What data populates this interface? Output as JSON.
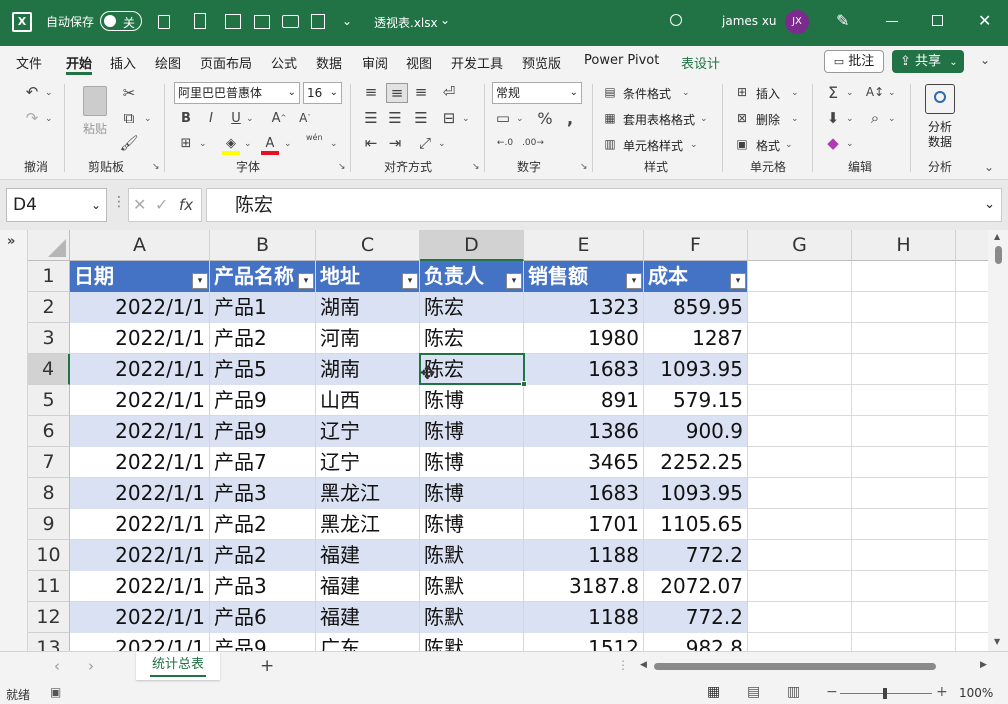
{
  "titlebar": {
    "autosave_label": "自动保存",
    "autosave_state": "关",
    "filename": "透视表.xlsx",
    "user_name": "james xu",
    "user_initials": "JX"
  },
  "menu": {
    "tabs": [
      "文件",
      "开始",
      "插入",
      "绘图",
      "页面布局",
      "公式",
      "数据",
      "审阅",
      "视图",
      "开发工具",
      "预览版",
      "Power Pivot",
      "表设计"
    ],
    "active_tab": "开始",
    "comment_button": "批注",
    "share_button": "共享"
  },
  "ribbon": {
    "groups": {
      "undo": "撤消",
      "clipboard": "剪贴板",
      "font": "字体",
      "align": "对齐方式",
      "number": "数字",
      "styles": "样式",
      "cells": "单元格",
      "edit": "编辑",
      "analysis": "分析"
    },
    "paste_label": "粘贴",
    "font_name": "阿里巴巴普惠体",
    "font_size": "16",
    "number_format": "常规",
    "cond_format": "条件格式",
    "table_format": "套用表格格式",
    "cell_style": "单元格样式",
    "insert": "插入",
    "delete": "删除",
    "format": "格式",
    "analyze_data_1": "分析",
    "analyze_data_2": "数据",
    "wen_label": "wén",
    "font_color": "#e81123",
    "highlight_color": "#ffff00"
  },
  "formula_bar": {
    "name_box": "D4",
    "fx": "fx",
    "content": "陈宏"
  },
  "grid": {
    "columns": [
      "A",
      "B",
      "C",
      "D",
      "E",
      "F",
      "G",
      "H"
    ],
    "row_numbers": [
      "1",
      "2",
      "3",
      "4",
      "5",
      "6",
      "7",
      "8",
      "9",
      "10",
      "11",
      "12",
      "13"
    ],
    "headers": [
      "日期",
      "产品名称",
      "地址",
      "负责人",
      "销售额",
      "成本"
    ],
    "rows": [
      [
        "2022/1/1",
        "产品1",
        "湖南",
        "陈宏",
        "1323",
        "859.95"
      ],
      [
        "2022/1/1",
        "产品2",
        "河南",
        "陈宏",
        "1980",
        "1287"
      ],
      [
        "2022/1/1",
        "产品5",
        "湖南",
        "陈宏",
        "1683",
        "1093.95"
      ],
      [
        "2022/1/1",
        "产品9",
        "山西",
        "陈博",
        "891",
        "579.15"
      ],
      [
        "2022/1/1",
        "产品9",
        "辽宁",
        "陈博",
        "1386",
        "900.9"
      ],
      [
        "2022/1/1",
        "产品7",
        "辽宁",
        "陈博",
        "3465",
        "2252.25"
      ],
      [
        "2022/1/1",
        "产品3",
        "黑龙江",
        "陈博",
        "1683",
        "1093.95"
      ],
      [
        "2022/1/1",
        "产品2",
        "黑龙江",
        "陈博",
        "1701",
        "1105.65"
      ],
      [
        "2022/1/1",
        "产品2",
        "福建",
        "陈默",
        "1188",
        "772.2"
      ],
      [
        "2022/1/1",
        "产品3",
        "福建",
        "陈默",
        "3187.8",
        "2072.07"
      ],
      [
        "2022/1/1",
        "产品6",
        "福建",
        "陈默",
        "1188",
        "772.2"
      ],
      [
        "2022/1/1",
        "产品9",
        "广东",
        "陈默",
        "1512",
        "982.8"
      ]
    ],
    "header_color": "#4472c4",
    "band_color": "#d9e1f2"
  },
  "sheet_tabs": {
    "active": "统计总表",
    "add": "+"
  },
  "status": {
    "ready": "就绪",
    "zoom": "100%"
  }
}
